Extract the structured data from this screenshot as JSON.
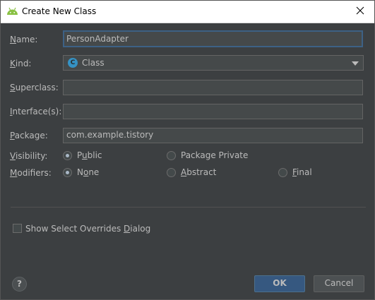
{
  "window": {
    "title": "Create New Class",
    "app_icon": "android-icon",
    "close_icon": "close-icon"
  },
  "form": {
    "name": {
      "label_u": "N",
      "label_rest": "ame:",
      "value": "PersonAdapter"
    },
    "kind": {
      "label_u": "K",
      "label_rest": "ind:",
      "value": "Class",
      "icon_letter": "C"
    },
    "superclass": {
      "label_u": "S",
      "label_rest": "uperclass:",
      "value": ""
    },
    "interfaces": {
      "label_u": "I",
      "label_rest": "nterface(s):",
      "value": ""
    },
    "package": {
      "label_u": "P",
      "label_rest": "ackage:",
      "value": "com.example.tistory"
    },
    "visibility": {
      "label_u": "V",
      "label_rest": "isibility:",
      "options": [
        {
          "pre": "P",
          "u": "u",
          "post": "blic",
          "selected": true
        },
        {
          "pre": "Package Private",
          "u": "",
          "post": "",
          "selected": false
        }
      ]
    },
    "modifiers": {
      "label_u": "M",
      "label_rest": "odifiers:",
      "options": [
        {
          "pre": "N",
          "u": "o",
          "post": "ne",
          "selected": true
        },
        {
          "pre": "",
          "u": "A",
          "post": "bstract",
          "selected": false
        },
        {
          "pre": "",
          "u": "F",
          "post": "inal",
          "selected": false
        }
      ]
    }
  },
  "overrides_checkbox": {
    "pre": "Show Select Overrides ",
    "u": "D",
    "post": "ialog",
    "checked": false
  },
  "buttons": {
    "help": "?",
    "ok": "OK",
    "cancel": "Cancel"
  },
  "colors": {
    "background": "#3c3f41",
    "ok_button": "#365880",
    "focus_border": "#3d6185",
    "class_icon": "#3592c4"
  }
}
